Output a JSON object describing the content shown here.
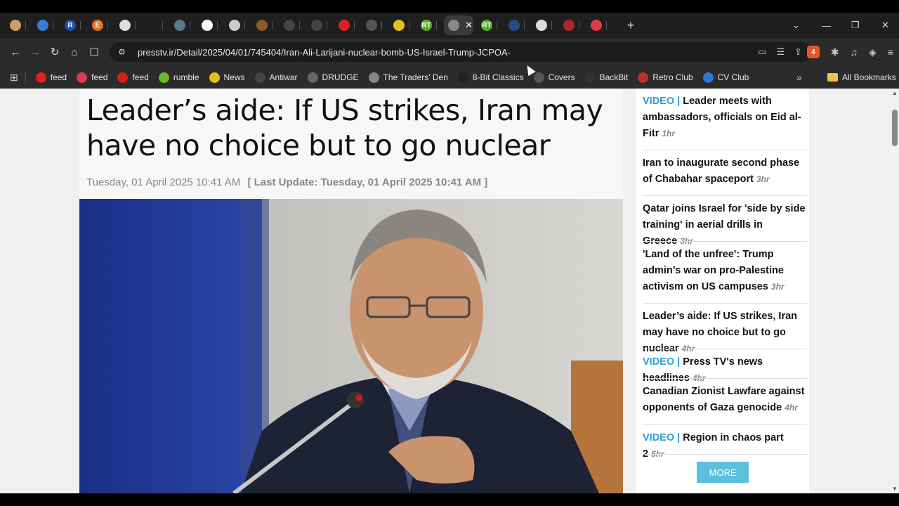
{
  "browser": {
    "tabs": [
      {
        "letter": "",
        "color": "#c8a060"
      },
      {
        "letter": "",
        "color": "#3a7bd5"
      },
      {
        "letter": "R",
        "color": "#1f4fa8"
      },
      {
        "letter": "E",
        "color": "#e8701a"
      },
      {
        "letter": "",
        "color": "#dddddd"
      },
      {
        "letter": "",
        "color": "#1f1f1f"
      },
      {
        "letter": "",
        "color": "#5a7a8a"
      },
      {
        "letter": "",
        "color": "#ffffff"
      },
      {
        "letter": "",
        "color": "#cccccc"
      },
      {
        "letter": "",
        "color": "#8a5a2a"
      },
      {
        "letter": "",
        "color": "#444444"
      },
      {
        "letter": "",
        "color": "#444444"
      },
      {
        "letter": "",
        "color": "#e02020"
      },
      {
        "letter": "",
        "color": "#555555"
      },
      {
        "letter": "",
        "color": "#e0c020"
      },
      {
        "letter": "RT",
        "color": "#5aaa2a"
      },
      {
        "active": true,
        "letter": "",
        "color": "#888888"
      },
      {
        "letter": "RT",
        "color": "#5aaa2a"
      },
      {
        "letter": "",
        "color": "#2a4a8a"
      },
      {
        "letter": "",
        "color": "#dddddd"
      },
      {
        "letter": "",
        "color": "#aa2a2a"
      },
      {
        "letter": "",
        "color": "#e03a4a"
      }
    ],
    "new_tab": "+",
    "url": "presstv.ir/Detail/2025/04/01/745404/Iran-Ali-Larijani-nuclear-bomb-US-Israel-Trump-JCPOA-",
    "brave_badge": "4",
    "bookmarks": [
      {
        "label": "feed",
        "icon": "youtube-icon",
        "color": "#e02020"
      },
      {
        "label": "feed",
        "icon": "reddit-icon",
        "color": "#e03a4a"
      },
      {
        "label": "feed",
        "icon": "gab-icon",
        "color": "#d02020"
      },
      {
        "label": "rumble",
        "icon": "rumble-icon",
        "color": "#6ab82a"
      },
      {
        "label": "News",
        "icon": "news-icon",
        "color": "#e0c020"
      },
      {
        "label": "Antiwar",
        "icon": "antiwar-icon",
        "color": "#444444"
      },
      {
        "label": "DRUDGE",
        "icon": "drudge-icon",
        "color": "#666666"
      },
      {
        "label": "The Traders' Den",
        "icon": "traders-den-icon",
        "color": "#888888"
      },
      {
        "label": "8-Bit Classics",
        "icon": "8bit-icon",
        "color": "#222222"
      },
      {
        "label": "Covers",
        "icon": "covers-icon",
        "color": "#555555"
      },
      {
        "label": "BackBit",
        "icon": "backbit-icon",
        "color": "#333333"
      },
      {
        "label": "Retro Club",
        "icon": "retro-club-icon",
        "color": "#c0302a"
      },
      {
        "label": "CV Club",
        "icon": "cv-club-icon",
        "color": "#2a7ad5"
      }
    ],
    "all_bookmarks": "All Bookmarks"
  },
  "article": {
    "headline": "Leader’s aide: If US strikes, Iran may have no choice but to go nuclear",
    "date": "Tuesday, 01 April 2025 10:41 AM",
    "last_update": "[ Last Update: Tuesday, 01 April 2025 10:41 AM ]"
  },
  "sidebar": {
    "items": [
      {
        "prefix": "VIDEO | ",
        "title": "Leader meets with ambassadors, officials on Eid al-Fitr",
        "age": "1hr"
      },
      {
        "prefix": "",
        "title": "Iran to inaugurate second phase of Chabahar spaceport",
        "age": "3hr"
      },
      {
        "prefix": "",
        "title": "Qatar joins Israel for 'side by side training' in aerial drills in Greece",
        "age": "3hr"
      },
      {
        "prefix": "",
        "title": "'Land of the unfree': Trump admin’s war on pro-Palestine activism on US campuses",
        "age": "3hr"
      },
      {
        "prefix": "",
        "title": "Leader’s aide: If US strikes, Iran may have no choice but to go nuclear",
        "age": "4hr"
      },
      {
        "prefix": "VIDEO | ",
        "title": "Press TV's news headlines",
        "age": "4hr"
      },
      {
        "prefix": "",
        "title": "Canadian Zionist Lawfare against opponents of Gaza genocide",
        "age": "4hr"
      },
      {
        "prefix": "VIDEO | ",
        "title": "Region in chaos part 2",
        "age": "5hr"
      }
    ],
    "more_label": "MORE"
  }
}
